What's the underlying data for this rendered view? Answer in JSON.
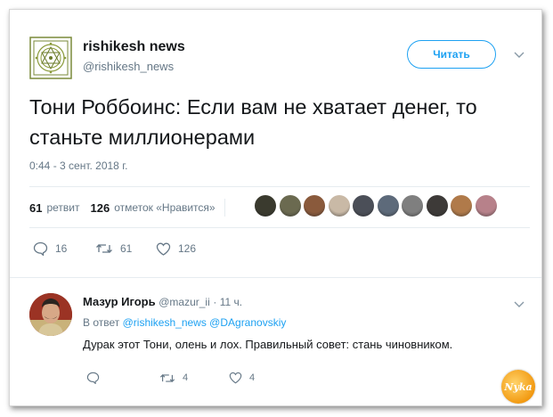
{
  "tweet": {
    "author_name": "rishikesh news",
    "author_handle": "@rishikesh_news",
    "follow_label": "Читать",
    "text": "Тони Роббоинс: Если вам не хватает денег, то станьте миллионерами",
    "timestamp": "0:44 - 3 сент. 2018 г.",
    "retweets_count": "61",
    "retweets_label": "ретвит",
    "likes_count": "126",
    "likes_label": "отметок «Нравится»",
    "actions": {
      "reply_count": "16",
      "retweet_count": "61",
      "like_count": "126"
    },
    "likers": [
      "#3a3a2e",
      "#6b6a50",
      "#8a5a3c",
      "#c9b9a6",
      "#4b4f58",
      "#5d6a7a",
      "#7f7f7f",
      "#3d3a38",
      "#b07a4a",
      "#b7818a"
    ]
  },
  "reply": {
    "author_name": "Мазур Игорь",
    "author_handle": "@mazur_ii",
    "time": "· 11 ч.",
    "in_reply_prefix": "В ответ",
    "in_reply_users": "@rishikesh_news @DAgranovskiy",
    "text": "Дурак этот Тони, олень и лох. Правильный совет: стань чиновником.",
    "retweet_count": "4",
    "like_count": "4"
  },
  "watermark": "Nyka",
  "colors": {
    "accent": "#1da1f2",
    "muted": "#657786",
    "text": "#14171a"
  }
}
